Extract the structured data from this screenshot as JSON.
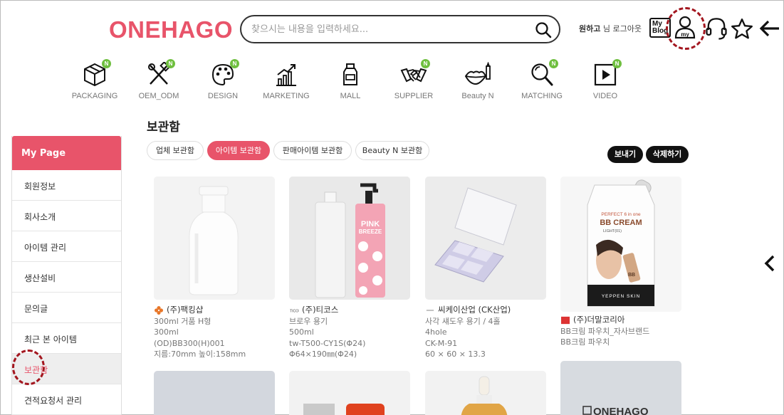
{
  "header": {
    "logo": "ONEHAGO",
    "search_placeholder": "찾으시는 내용을 입력하세요...",
    "user_name": "원하고",
    "user_suffix": "님 로그아웃",
    "myblog_label": "My Blog"
  },
  "categories": [
    {
      "label": "PACKAGING",
      "icon": "box-icon",
      "badge": "N"
    },
    {
      "label": "OEM_ODM",
      "icon": "tools-icon",
      "badge": "N"
    },
    {
      "label": "DESIGN",
      "icon": "palette-icon",
      "badge": "N"
    },
    {
      "label": "MARKETING",
      "icon": "chart-icon",
      "badge": ""
    },
    {
      "label": "MALL",
      "icon": "bottle-icon",
      "badge": ""
    },
    {
      "label": "SUPPLIER",
      "icon": "handshake-icon",
      "badge": "N"
    },
    {
      "label": "Beauty N",
      "icon": "lips-icon",
      "badge": ""
    },
    {
      "label": "MATCHING",
      "icon": "magnifier-icon",
      "badge": "N"
    },
    {
      "label": "VIDEO",
      "icon": "play-icon",
      "badge": "N"
    }
  ],
  "page_title": "보관함",
  "sidebar": {
    "title": "My Page",
    "items": [
      {
        "label": "회원정보"
      },
      {
        "label": "회사소개"
      },
      {
        "label": "아이템 관리"
      },
      {
        "label": "생산설비"
      },
      {
        "label": "문의글"
      },
      {
        "label": "최근 본 아이템"
      },
      {
        "label": "보관함"
      },
      {
        "label": "견적요청서 관리"
      }
    ],
    "active_index": 6
  },
  "tabs": [
    {
      "label": "업체 보관함"
    },
    {
      "label": "아이템 보관함"
    },
    {
      "label": "판매아이템 보관함"
    },
    {
      "label": "Beauty N 보관함"
    }
  ],
  "active_tab": 1,
  "actions": {
    "send": "보내기",
    "delete": "삭제하기"
  },
  "products": [
    {
      "company": "(주)팩킹샵",
      "lines": [
        "300ml 거품 H형",
        "300ml",
        "(OD)BB300(H)001",
        "지름:70mm 높이:158mm"
      ]
    },
    {
      "company": "(주)티코스",
      "lines": [
        "브로우 용기",
        "500ml",
        "tw-T500-CY1S(Φ24)",
        "Φ64×190㎜(Φ24)"
      ]
    },
    {
      "company": "씨케이산업 (CK산업)",
      "lines": [
        "사각 섀도우 용기 / 4홀",
        "4hole",
        "CK-M-91",
        "60 × 60 × 13.3"
      ]
    },
    {
      "company": "(주)더말코리아",
      "lines": [
        "BB크림 파우치_자사브랜드",
        "BB크림 파우치"
      ]
    }
  ],
  "product_images": {
    "bb_pouch": {
      "line1": "PERFECT 6 in one",
      "line2": "BB CREAM",
      "line3": "LIGHT(01)",
      "brand": "YEPPEN SKIN",
      "tube_text": "BB"
    },
    "pink_bottle": {
      "text1": "PINK",
      "text2": "BREEZE"
    },
    "bottom_logo": "ONEHAGO"
  },
  "colors": {
    "accent": "#e8546a",
    "annotation": "#a3161f",
    "badge": "#6fbf3f"
  }
}
